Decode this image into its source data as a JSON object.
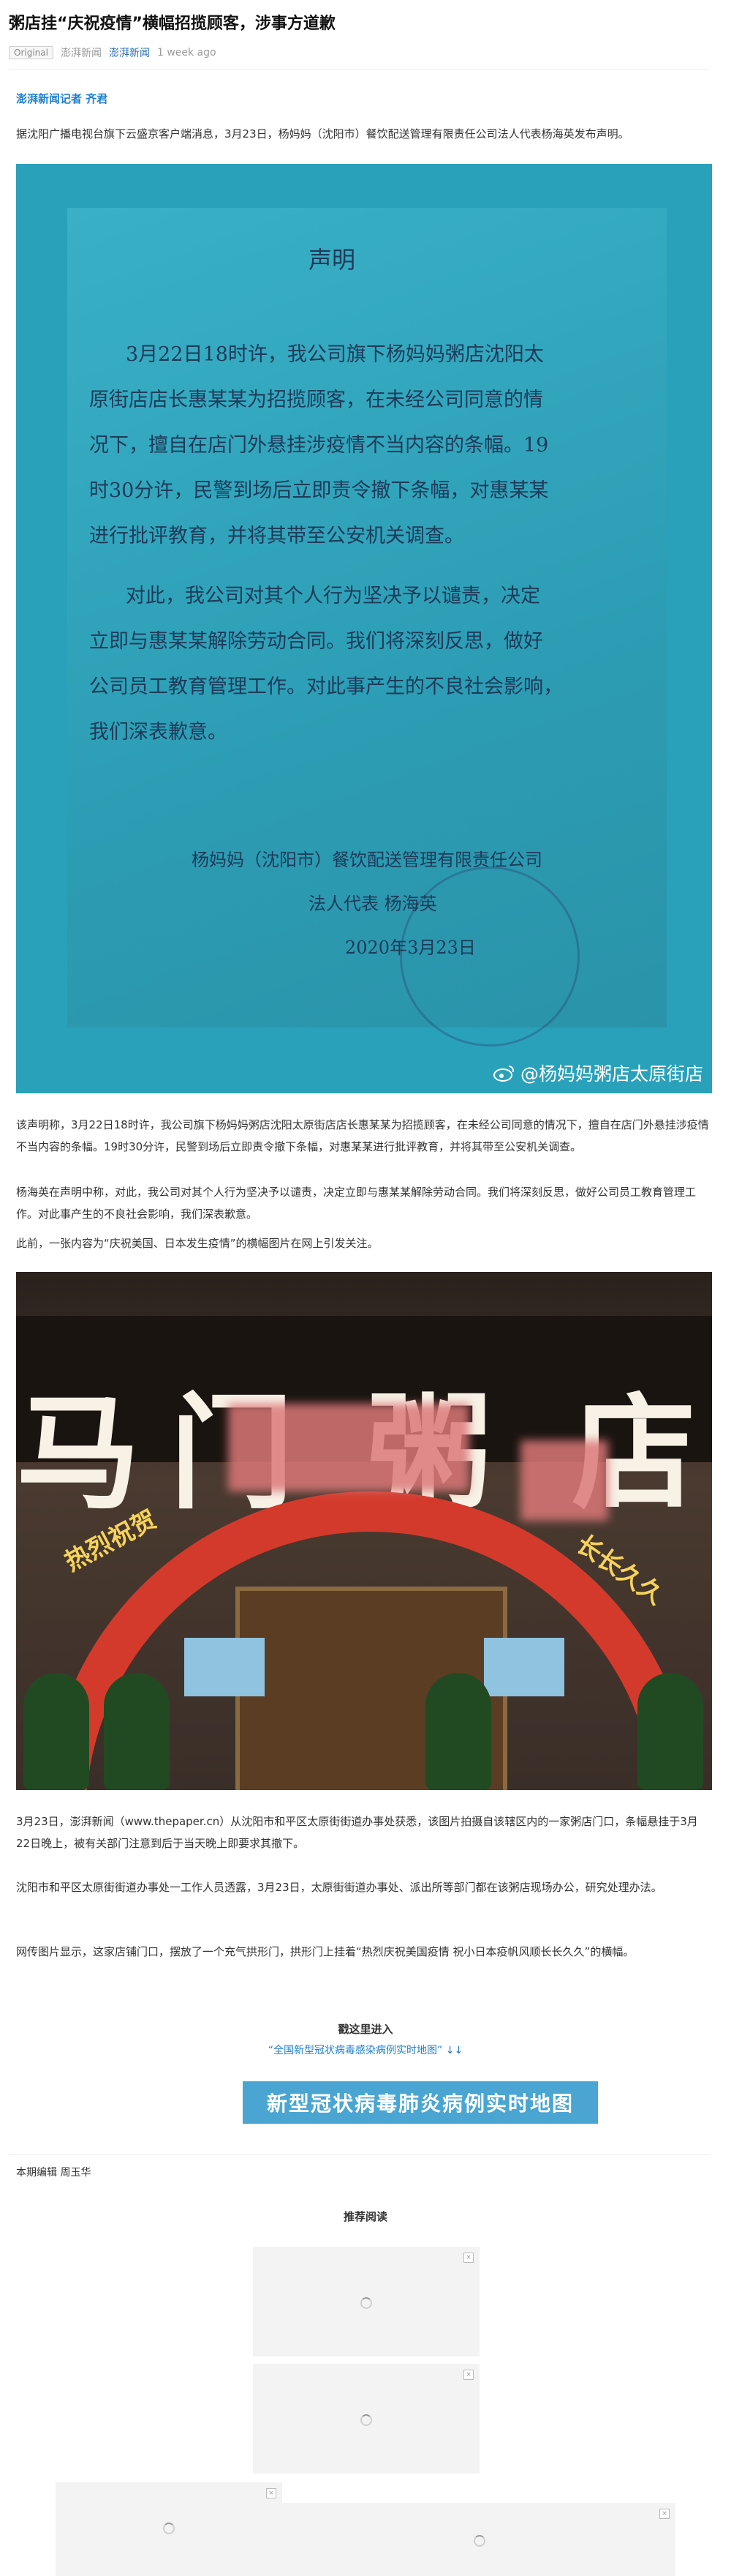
{
  "article": {
    "title": "粥店挂“庆祝疫情”横幅招揽顾客，涉事方道歉",
    "original_tag": "Original",
    "source": "澎湃新闻",
    "account": "澎湃新闻",
    "time": "1 week ago",
    "reporter": "澎湃新闻记者 齐君",
    "lead": "据沈阳广播电视台旗下云盛京客户端消息，3月23日，杨妈妈（沈阳市）餐饮配送管理有限责任公司法人代表杨海英发布声明。",
    "body1": "该声明称，3月22日18时许，我公司旗下杨妈妈粥店沈阳太原街店店长惠某某为招揽顾客，在未经公司同意的情况下，擅自在店门外悬挂涉疫情不当内容的条幅。19时30分许，民警到场后立即责令撤下条幅，对惠某某进行批评教育，并将其带至公安机关调查。",
    "body2": "杨海英在声明中称，对此，我公司对其个人行为坚决予以谴责，决定立即与惠某某解除劳动合同。我们将深刻反思，做好公司员工教育管理工作。对此事产生的不良社会影响，我们深表歉意。",
    "body3": "此前，一张内容为“庆祝美国、日本发生疫情”的横幅图片在网上引发关注。",
    "body4": "3月23日，澎湃新闻（www.thepaper.cn）从沈阳市和平区太原街街道办事处获悉，该图片拍摄自该辖区内的一家粥店门口，条幅悬挂于3月22日晚上，被有关部门注意到后于当天晚上即要求其撤下。",
    "body5": "沈阳市和平区太原街街道办事处一工作人员透露，3月23日，太原街街道办事处、派出所等部门都在该粥店现场办公，研究处理办法。",
    "body6": "网传图片显示，这家店铺门口，摆放了一个充气拱形门，拱形门上挂着“热烈庆祝美国疫情 祝小日本疫帆风顺长长久久”的横幅。"
  },
  "notice_image": {
    "heading": "声明",
    "lines": [
      "3月22日18时许，我公司旗下杨妈妈粥店沈阳太",
      "原街店店长惠某某为招揽顾客，在未经公司同意的情",
      "况下，擅自在店门外悬挂涉疫情不当内容的条幅。19",
      "时30分许，民警到场后立即责令撤下条幅，对惠某某",
      "进行批评教育，并将其带至公安机关调查。",
      "对此，我公司对其个人行为坚决予以谴责，决定",
      "立即与惠某某解除劳动合同。我们将深刻反思，做好",
      "公司员工教育管理工作。对此事产生的不良社会影响，",
      "我们深表歉意。"
    ],
    "signature_company": "杨妈妈（沈阳市）餐饮配送管理有限责任公司",
    "signature_person": "法人代表  杨海英",
    "signature_date": "2020年3月23日",
    "watermark": "@杨妈妈粥店太原街店"
  },
  "store_image": {
    "sign_chars": [
      "马",
      "门",
      "粥",
      "店"
    ],
    "arch_left": "热烈祝贺",
    "arch_right": "长长久久"
  },
  "more": {
    "label": "戳这里进入",
    "link": "“全国新型冠状病毒感染病例实时地图” ↓↓",
    "banner": "新型冠状病毒肺炎病例实时地图"
  },
  "editor": "本期编辑 周玉华",
  "recommended": {
    "title": "推荐阅读"
  },
  "colors": {
    "accent_blue": "#1d7fd0",
    "notice_bg": "#2aa1ba",
    "banner_bg": "#4aa5d2"
  }
}
